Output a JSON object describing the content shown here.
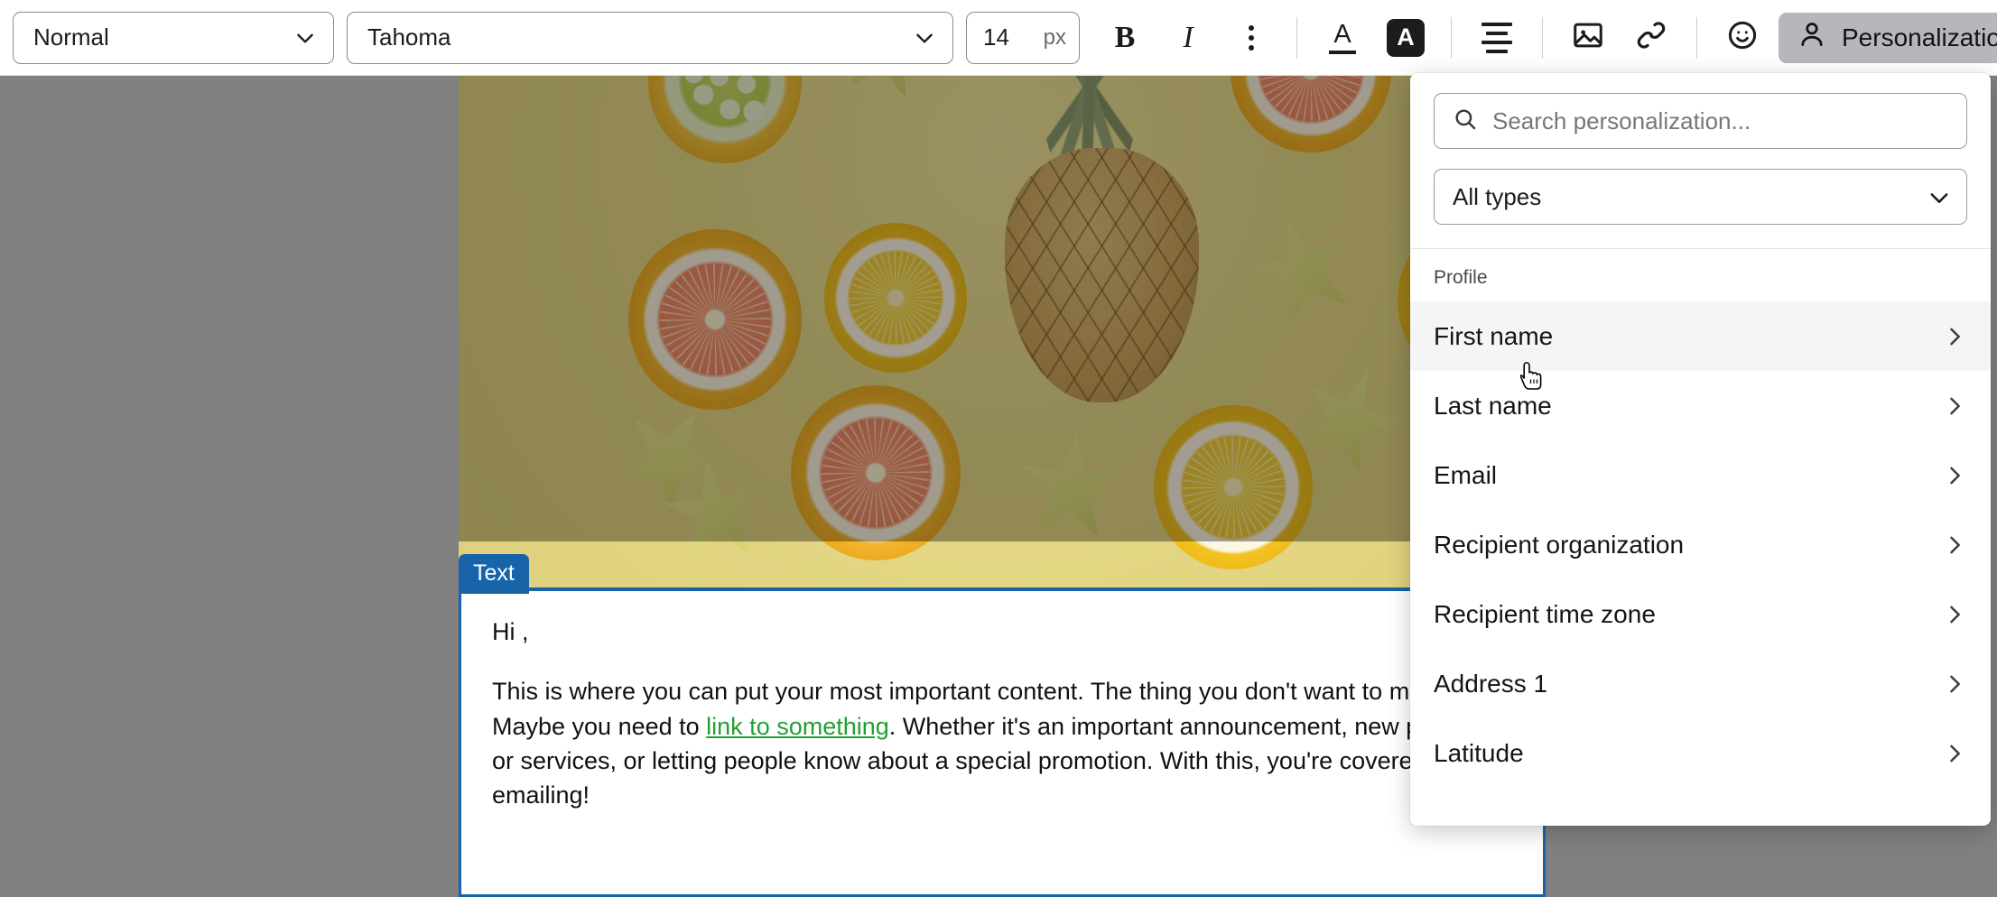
{
  "toolbar": {
    "paragraph_style": "Normal",
    "font_family": "Tahoma",
    "font_size": "14",
    "font_size_unit": "px",
    "bold_label": "B",
    "italic_label": "I",
    "more_label": "More formatting",
    "text_color_glyph": "A",
    "bg_color_glyph": "A",
    "align_label": "Align",
    "image_label": "Insert image",
    "link_label": "Insert link",
    "emoji_label": "Insert emoji",
    "personalization_label": "Personalization"
  },
  "panel": {
    "search": {
      "placeholder": "Search personalization...",
      "value": ""
    },
    "type_filter": {
      "selected": "All types"
    },
    "group_label": "Profile",
    "items": [
      {
        "label": "First name",
        "highlighted": true
      },
      {
        "label": "Last name",
        "highlighted": false
      },
      {
        "label": "Email",
        "highlighted": false
      },
      {
        "label": "Recipient organization",
        "highlighted": false
      },
      {
        "label": "Recipient time zone",
        "highlighted": false
      },
      {
        "label": "Address 1",
        "highlighted": false
      },
      {
        "label": "Latitude",
        "highlighted": false
      }
    ]
  },
  "canvas": {
    "image_block": {
      "alt": "Assorted citrus fruit slices, star fruit and a pineapple on a yellow background"
    },
    "text_block": {
      "tag": "Text",
      "greeting": "Hi ,",
      "body_part_1": "This is where you can put your most important content. The thing you don't want ",
      "body_part_2": "to miss. Maybe you need to ",
      "link_text": "link to something",
      "body_part_3": ". Whether it's an important announcement, new products or services, or letting people know about a special promotion. With this, you're covered. Happy emailing!"
    }
  },
  "colors": {
    "accent_blue": "#1764a8",
    "link_green": "#22a031",
    "active_button_bg": "#b5b7bb",
    "backdrop_gray": "#808080",
    "row_highlight": "#f4f5f7"
  }
}
